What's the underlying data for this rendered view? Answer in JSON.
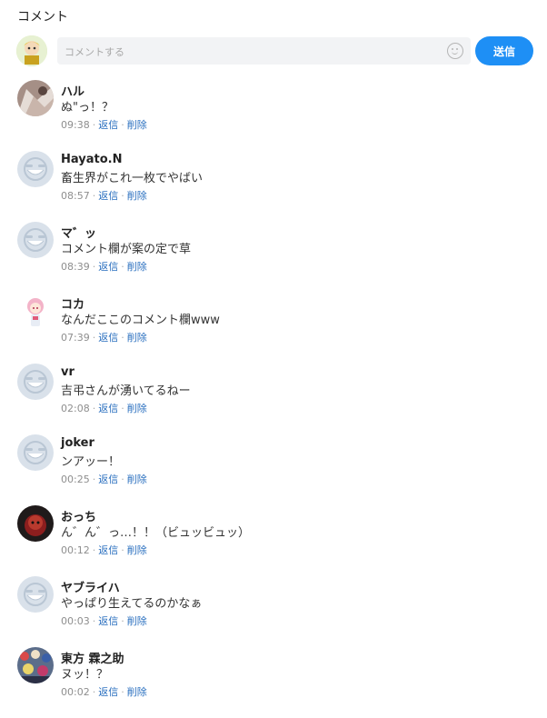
{
  "title": "コメント",
  "composer": {
    "placeholder": "コメントする",
    "send_label": "送信"
  },
  "actions": {
    "reply": "返信",
    "delete": "削除",
    "separator": "·"
  },
  "comments": [
    {
      "name": "ハル",
      "text": "ぬ\"っ！？",
      "time": "09:38",
      "avatar": "photo-hands"
    },
    {
      "name": "Hayato.N",
      "text": "畜生界がこれ一枚でやばい",
      "time": "08:57",
      "avatar": "default"
    },
    {
      "name": "マ゛ッ",
      "text": "コメント欄が案の定で草",
      "time": "08:39",
      "avatar": "default"
    },
    {
      "name": "コカ",
      "text": "なんだここのコメント欄www",
      "time": "07:39",
      "avatar": "anime-pink"
    },
    {
      "name": "vr",
      "text": "吉弔さんが湧いてるねー",
      "time": "02:08",
      "avatar": "default"
    },
    {
      "name": "joker",
      "text": "ンアッー！",
      "time": "00:25",
      "avatar": "default"
    },
    {
      "name": "おっち",
      "text": "ん゛ん゛っ…！！（ビュッビュッ）",
      "time": "00:12",
      "avatar": "dark-red"
    },
    {
      "name": "ヤブライハ",
      "text": "やっぱり生えてるのかなぁ",
      "time": "00:03",
      "avatar": "default"
    },
    {
      "name": "東方 霖之助",
      "text": "ヌッ！？",
      "time": "00:02",
      "avatar": "crowd"
    }
  ]
}
